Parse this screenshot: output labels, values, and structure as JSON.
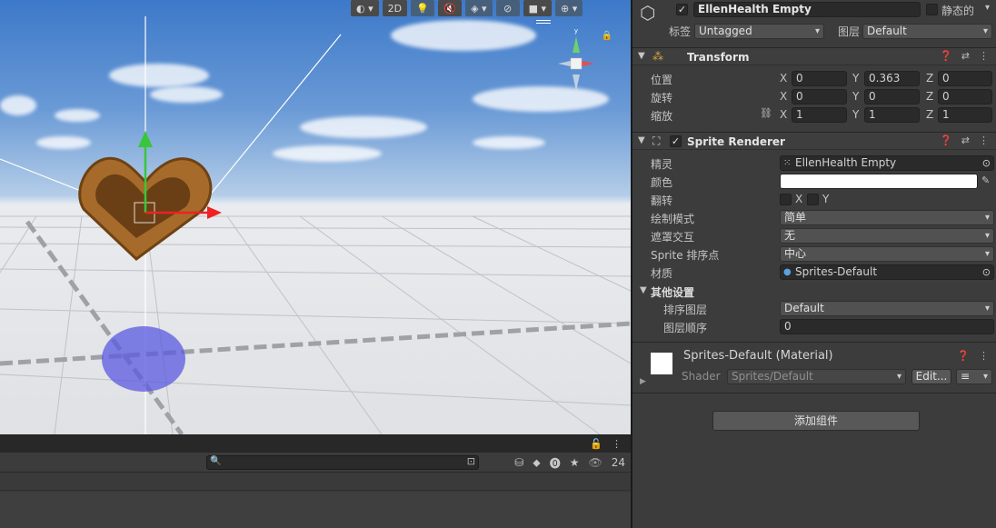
{
  "scene": {
    "toolbar": [
      {
        "name": "draw-mode-button",
        "label": "◐ ▾",
        "active": false
      },
      {
        "name": "2d-toggle-button",
        "label": "2D",
        "active": false
      },
      {
        "name": "lighting-toggle-button",
        "label": "💡",
        "active": true
      },
      {
        "name": "audio-toggle-button",
        "label": "🔇",
        "active": false
      },
      {
        "name": "effects-button",
        "label": "◈ ▾",
        "active": true
      },
      {
        "name": "hidden-objects-button",
        "label": "⊘",
        "active": true
      },
      {
        "name": "camera-button",
        "label": "■ ▾",
        "active": false
      },
      {
        "name": "gizmos-button",
        "label": "⊕ ▾",
        "active": true
      }
    ]
  },
  "bottom_panel": {
    "search": {
      "placeholder": ""
    },
    "search_icon": "🔍",
    "hidden_count": "24",
    "icons": [
      "hierarchy-filter-icon",
      "label-icon",
      "error-icon",
      "star-icon",
      "eye-icon"
    ]
  },
  "inspector": {
    "object": {
      "name": "EllenHealth Empty",
      "static_label": "静态的",
      "tag_label": "标签",
      "tag_value": "Untagged",
      "layer_label": "图层",
      "layer_value": "Default"
    },
    "transform": {
      "title": "Transform",
      "position_label": "位置",
      "rotation_label": "旋转",
      "scale_label": "缩放",
      "position": {
        "x": "0",
        "y": "0.363",
        "z": "0"
      },
      "rotation": {
        "x": "0",
        "y": "0",
        "z": "0"
      },
      "scale": {
        "x": "1",
        "y": "1",
        "z": "1"
      },
      "axis_x": "X",
      "axis_y": "Y",
      "axis_z": "Z"
    },
    "sprite_renderer": {
      "title": "Sprite Renderer",
      "sprite_label": "精灵",
      "sprite_value": "EllenHealth Empty",
      "color_label": "颜色",
      "color_value": "#ffffff",
      "flip_label": "翻转",
      "flip_x": "X",
      "flip_y": "Y",
      "draw_mode_label": "绘制模式",
      "draw_mode_value": "简单",
      "mask_label": "遮罩交互",
      "mask_value": "无",
      "sort_point_label": "Sprite 排序点",
      "sort_point_value": "中心",
      "material_label": "材质",
      "material_value": "Sprites-Default",
      "other_settings_label": "其他设置",
      "sorting_layer_label": "排序图层",
      "sorting_layer_value": "Default",
      "order_label": "图层顺序",
      "order_value": "0"
    },
    "material": {
      "title": "Sprites-Default (Material)",
      "shader_label": "Shader",
      "shader_value": "Sprites/Default",
      "edit_label": "Edit..."
    },
    "add_component_label": "添加组件"
  }
}
